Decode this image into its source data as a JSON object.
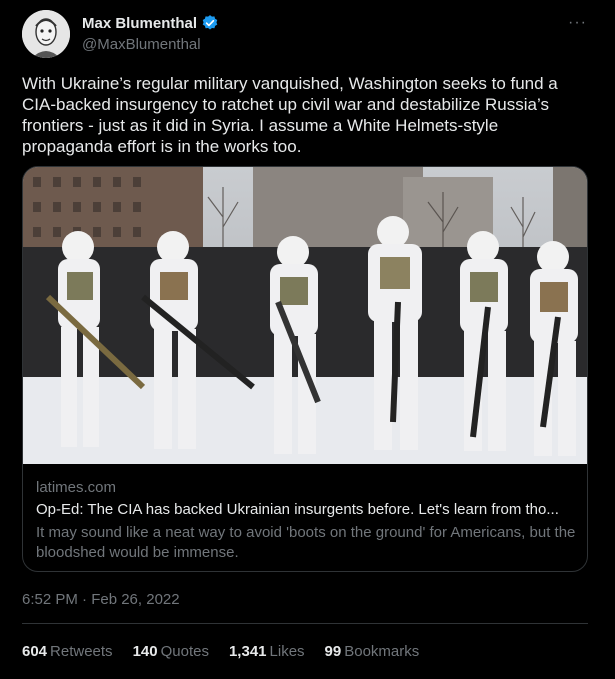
{
  "author": {
    "display_name": "Max Blumenthal",
    "handle": "@MaxBlumenthal",
    "avatar_icon": "avatar-sketch",
    "verified_color": "#1d9bf0"
  },
  "more_label": "···",
  "tweet": {
    "text": "With Ukraine’s regular military vanquished, Washington seeks to fund a CIA-backed insurgency to ratchet up civil war and destabilize Russia’s frontiers - just as it did in Syria. I assume a White Helmets-style propaganda effort is in the works too."
  },
  "card": {
    "domain": "latimes.com",
    "title": "Op-Ed: The CIA has backed Ukrainian insurgents before. Let's learn from tho...",
    "description": "It may sound like a neat way to avoid 'boots on the ground' for Americans, but the bloodshed would be immense."
  },
  "timestamp": "6:52 PM · Feb 26, 2022",
  "stats": [
    {
      "count": "604",
      "label": "Retweets"
    },
    {
      "count": "140",
      "label": "Quotes"
    },
    {
      "count": "1,341",
      "label": "Likes"
    },
    {
      "count": "99",
      "label": "Bookmarks"
    }
  ]
}
